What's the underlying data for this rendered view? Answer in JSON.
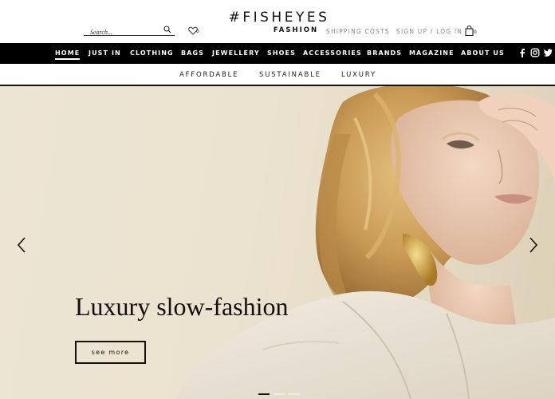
{
  "header": {
    "search_placeholder": "Search...",
    "wishlist_count": "0",
    "logo_line1": "#FISHEYES",
    "logo_line2": "FASHION",
    "shipping_label": "SHIPPING COSTS",
    "signup_label": "SIGN UP / LOG IN",
    "bag_count": "0"
  },
  "nav": {
    "items": [
      "HOME",
      "JUST IN",
      "CLOTHING",
      "BAGS",
      "JEWELLERY",
      "SHOES",
      "ACCESSORIES",
      "BRANDS",
      "MAGAZINE",
      "ABOUT US"
    ],
    "active": "HOME",
    "social": [
      "facebook-icon",
      "instagram-icon",
      "twitter-icon"
    ]
  },
  "subnav": {
    "items": [
      "AFFORDABLE",
      "SUSTAINABLE",
      "LUXURY"
    ]
  },
  "hero": {
    "title": "Luxury slow-fashion",
    "button_label": "see more",
    "slide_count": 3,
    "active_slide": 1
  },
  "colors": {
    "nav_background": "#000000",
    "hero_background": "#ebe2cf",
    "text": "#111111",
    "muted_text": "#888888"
  }
}
